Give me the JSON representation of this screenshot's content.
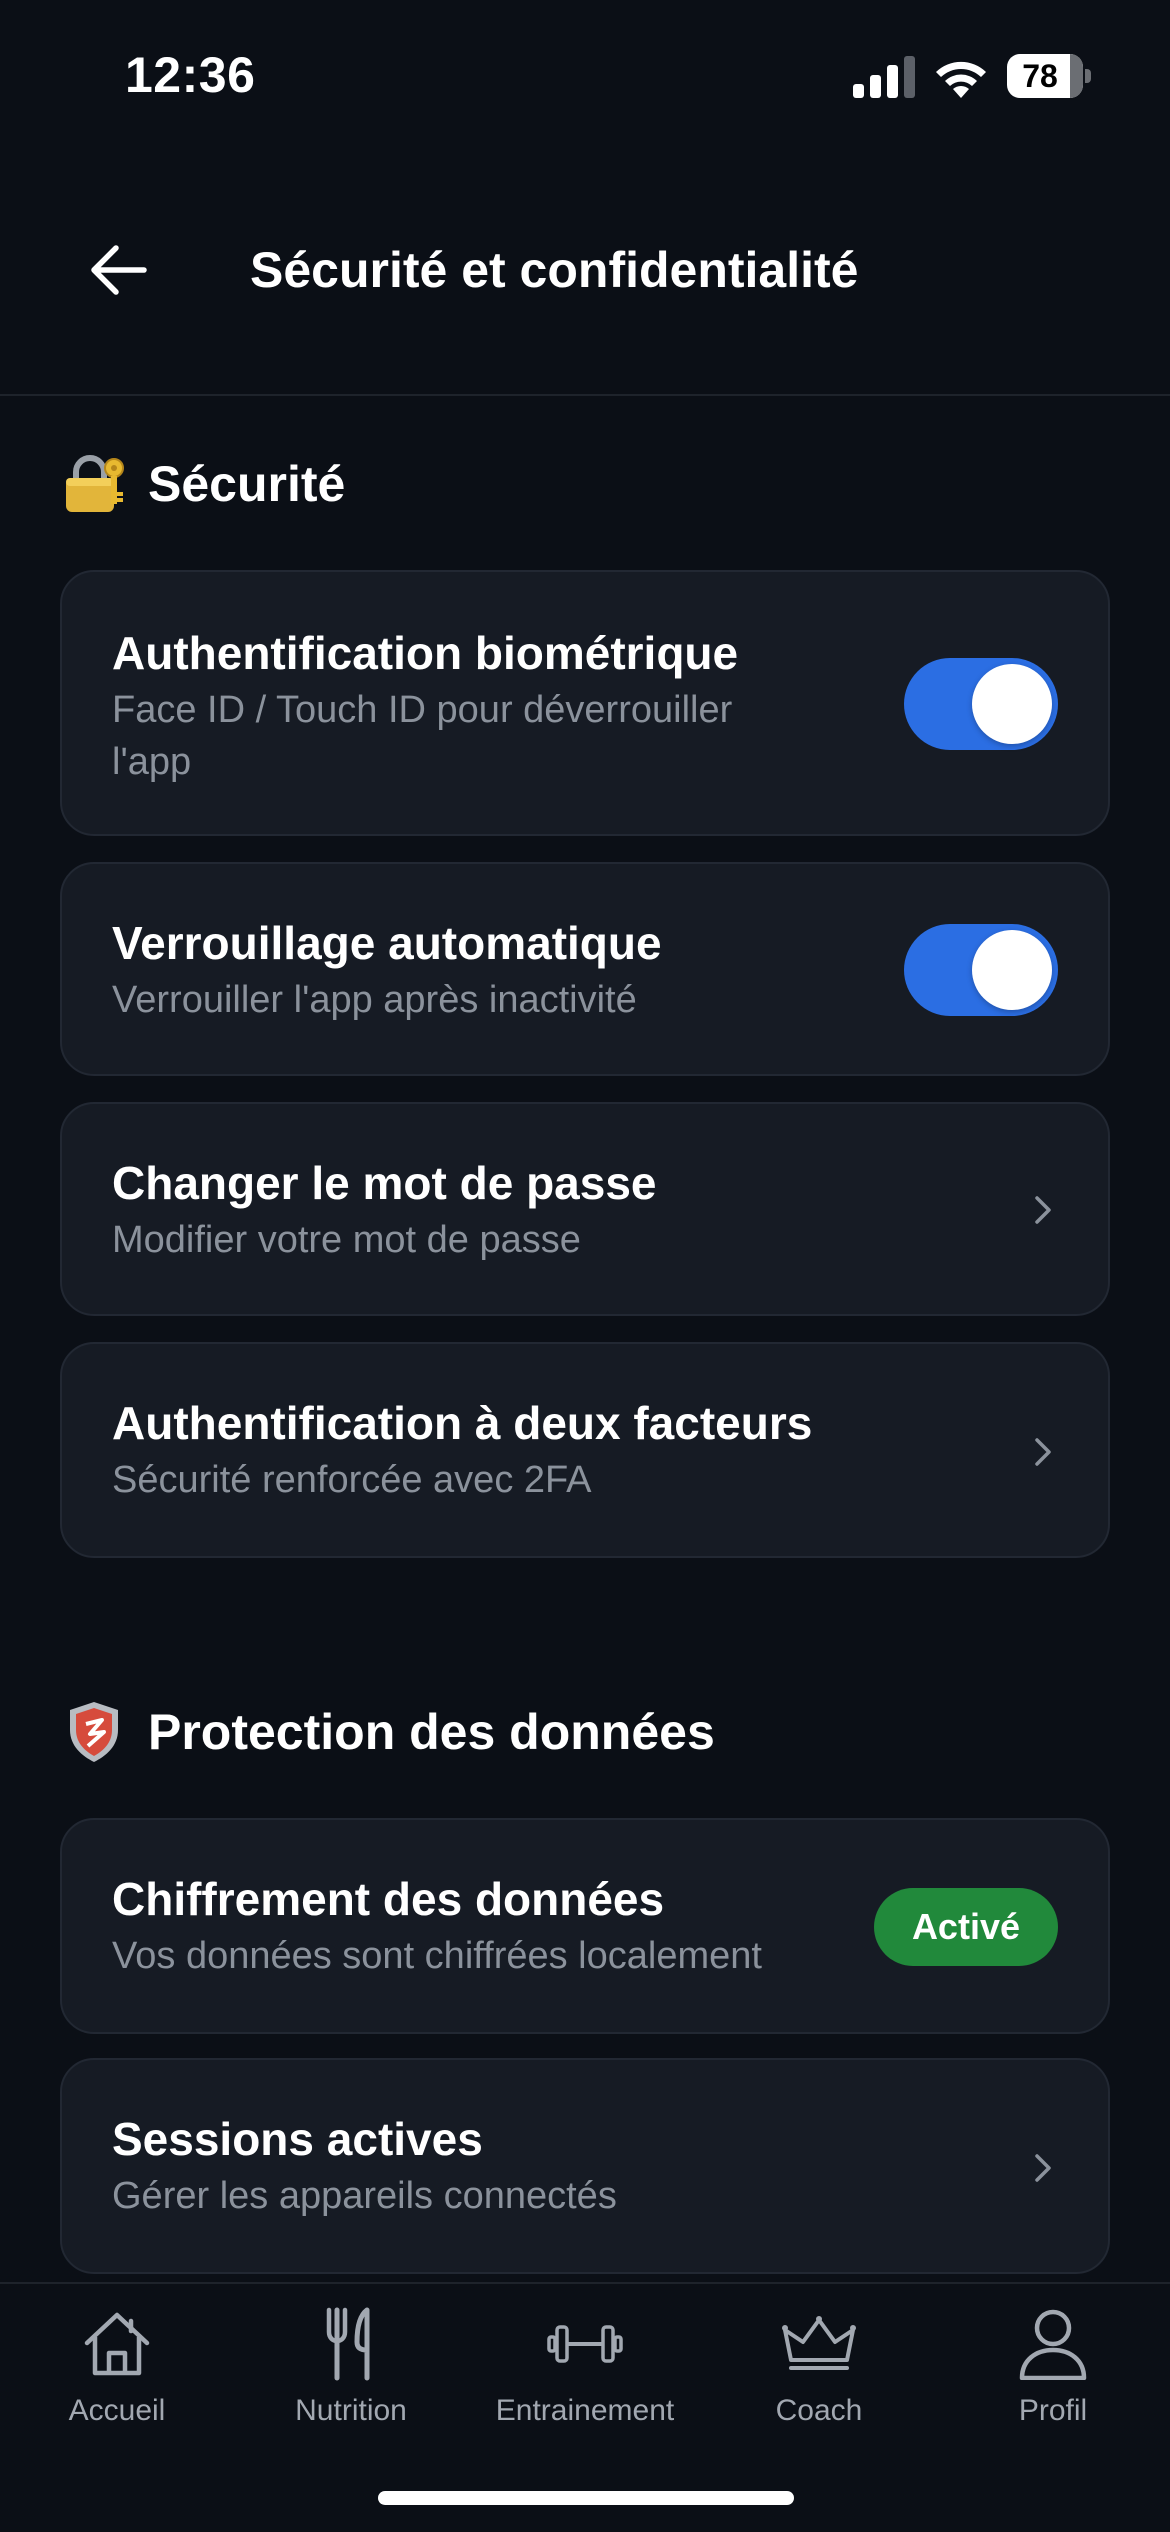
{
  "status_bar": {
    "time": "12:36",
    "battery_level": "78",
    "signal_bars_active": 3,
    "signal_bars_total": 4
  },
  "header": {
    "title": "Sécurité et confidentialité",
    "back_icon": "arrow-left-icon"
  },
  "sections": {
    "security": {
      "title": "Sécurité",
      "icon": "lock-with-key-icon",
      "items": [
        {
          "title": "Authentification biométrique",
          "subtitle_line1": "Face ID / Touch ID pour déverrouiller",
          "subtitle_line2": "l'app",
          "control": "toggle",
          "enabled": true
        },
        {
          "title": "Verrouillage automatique",
          "subtitle": "Verrouiller l'app après inactivité",
          "control": "toggle",
          "enabled": true
        },
        {
          "title": "Changer le mot de passe",
          "subtitle": "Modifier votre mot de passe",
          "control": "chevron"
        },
        {
          "title": "Authentification à deux facteurs",
          "subtitle": "Sécurité renforcée avec 2FA",
          "control": "chevron"
        }
      ]
    },
    "data_protection": {
      "title": "Protection des données",
      "icon": "shield-icon",
      "items": [
        {
          "title": "Chiffrement des données",
          "subtitle": "Vos données sont chiffrées localement",
          "control": "badge",
          "badge": "Activé"
        },
        {
          "title": "Sessions actives",
          "subtitle": "Gérer les appareils connectés",
          "control": "chevron"
        }
      ]
    }
  },
  "tab_bar": {
    "tabs": [
      {
        "label": "Accueil",
        "icon": "home-icon"
      },
      {
        "label": "Nutrition",
        "icon": "fork-knife-icon"
      },
      {
        "label": "Entrainement",
        "icon": "dumbbell-icon"
      },
      {
        "label": "Coach",
        "icon": "crown-icon"
      },
      {
        "label": "Profil",
        "icon": "user-icon"
      }
    ]
  },
  "colors": {
    "background": "#0b0f16",
    "card": "#161b24",
    "toggle_on": "#2b6ee3",
    "badge_green": "#21893b",
    "muted_text": "#8b929c"
  }
}
